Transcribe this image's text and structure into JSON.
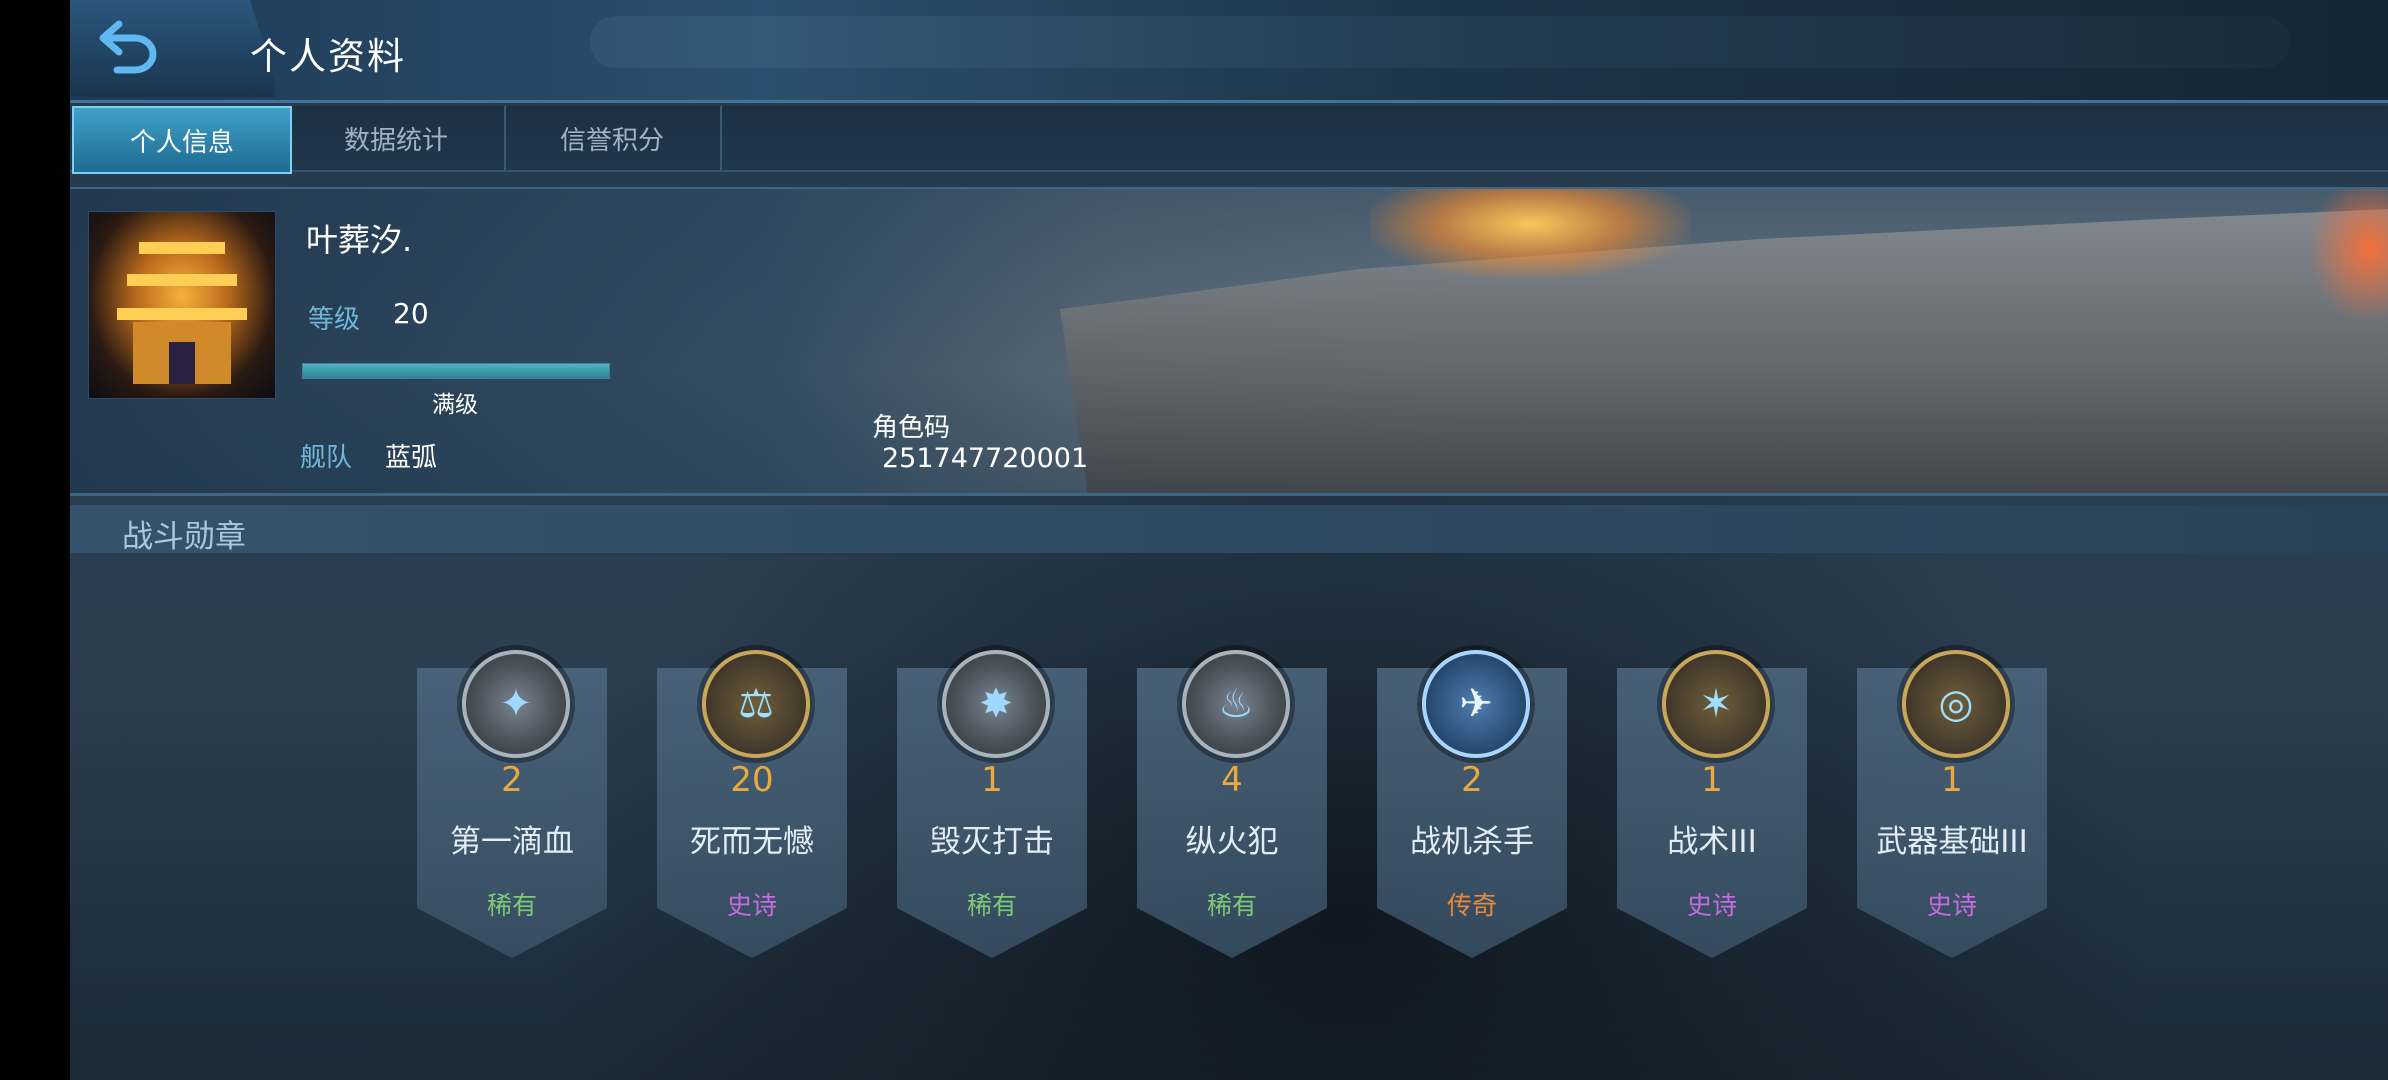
{
  "header": {
    "title": "个人资料",
    "back_icon": "back-arrow-icon"
  },
  "tabs": [
    {
      "label": "个人信息",
      "active": true
    },
    {
      "label": "数据统计",
      "active": false
    },
    {
      "label": "信誉积分",
      "active": false
    }
  ],
  "profile": {
    "name": "叶葬汐.",
    "level_label": "等级",
    "level_value": "20",
    "level_progress": 1.0,
    "max_level_text": "满级",
    "fleet_label": "舰队",
    "fleet_value": "蓝弧",
    "role_code_label": "角色码",
    "role_code_value": "251747720001"
  },
  "section": {
    "title": "战斗勋章"
  },
  "medals": [
    {
      "count": "2",
      "name": "第一滴血",
      "rarity": "稀有",
      "rarity_color": "#7ec87a",
      "frame": "silver",
      "icon": "blood-drop-icon"
    },
    {
      "count": "20",
      "name": "死而无憾",
      "rarity": "史诗",
      "rarity_color": "#c56de0",
      "frame": "gold",
      "icon": "scales-icon"
    },
    {
      "count": "1",
      "name": "毁灭打击",
      "rarity": "稀有",
      "rarity_color": "#7ec87a",
      "frame": "silver",
      "icon": "explosion-icon"
    },
    {
      "count": "4",
      "name": "纵火犯",
      "rarity": "稀有",
      "rarity_color": "#7ec87a",
      "frame": "silver",
      "icon": "flame-icon"
    },
    {
      "count": "2",
      "name": "战机杀手",
      "rarity": "传奇",
      "rarity_color": "#e88a3a",
      "frame": "legend",
      "icon": "plane-crosshair-icon"
    },
    {
      "count": "1",
      "name": "战术III",
      "rarity": "史诗",
      "rarity_color": "#c56de0",
      "frame": "gold",
      "icon": "palm-star-icon"
    },
    {
      "count": "1",
      "name": "武器基础III",
      "rarity": "史诗",
      "rarity_color": "#c56de0",
      "frame": "gold",
      "icon": "target-icon"
    }
  ],
  "colors": {
    "accent": "#3fa0c8",
    "count": "#e9a93c",
    "label_blue": "#6fb6d8"
  }
}
